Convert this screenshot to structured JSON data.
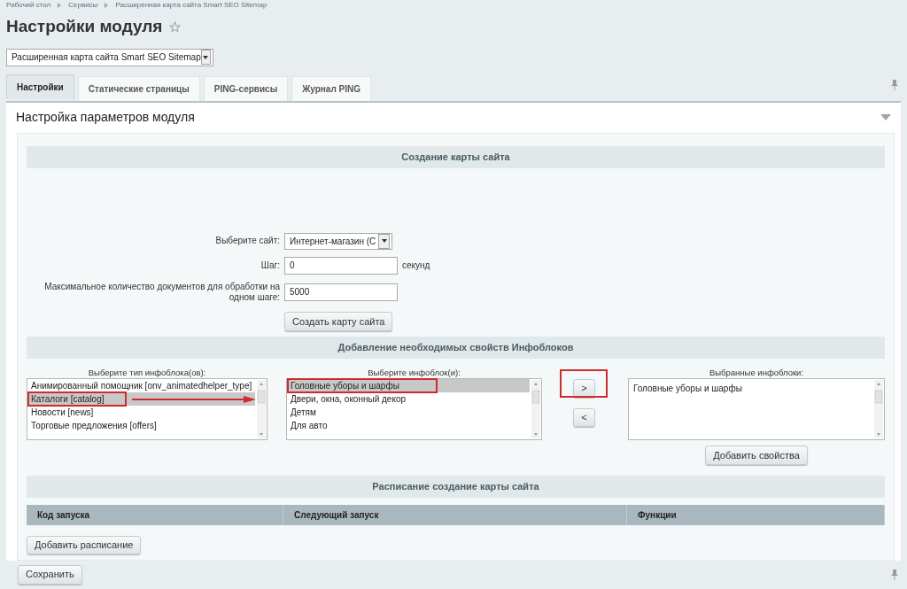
{
  "breadcrumbs": [
    "Рабочий стол",
    "Сервисы",
    "Расширенная карта сайта Smart SEO Sitemap"
  ],
  "title": "Настройки модуля",
  "module_select": {
    "value": "Расширенная карта сайта Smart SEO Sitemap"
  },
  "tabs": [
    {
      "label": "Настройки",
      "selected": true
    },
    {
      "label": "Статические страницы",
      "selected": false
    },
    {
      "label": "PING-сервисы",
      "selected": false
    },
    {
      "label": "Журнал PING",
      "selected": false
    }
  ],
  "panel_title": "Настройка параметров модуля",
  "section_create": {
    "heading": "Создание карты сайта",
    "fields": [
      {
        "kind": "select",
        "label": "Выберите сайт:",
        "value": "Интернет-магазин (С"
      },
      {
        "kind": "input",
        "label": "Шаг:",
        "value": "0",
        "suffix": "секунд"
      },
      {
        "kind": "input",
        "label": "Максимальное количество документов для обработки на одном шаге:",
        "value": "5000"
      }
    ],
    "button": "Создать карту сайта"
  },
  "section_props": {
    "heading": "Добавление необходимых свойств Инфоблоков",
    "types_label": "Выберите тип инфоблока(ов):",
    "types": [
      {
        "label": "Анимированный помощник [onv_animatedhelper_type]",
        "selected": false,
        "highlighted": false
      },
      {
        "label": "Каталоги [catalog]",
        "selected": true,
        "highlighted": true
      },
      {
        "label": "Новости [news]",
        "selected": false,
        "highlighted": false
      },
      {
        "label": "Торговые предложения [offers]",
        "selected": false,
        "highlighted": false
      }
    ],
    "iblocks_label": "Выберите инфоблок(и):",
    "iblocks": [
      {
        "label": "Головные уборы и шарфы",
        "selected": true,
        "highlighted": true
      },
      {
        "label": "Двери, окна, оконный декор",
        "selected": false,
        "highlighted": false
      },
      {
        "label": "Детям",
        "selected": false,
        "highlighted": false
      },
      {
        "label": "Для авто",
        "selected": false,
        "highlighted": false
      }
    ],
    "move_buttons": [
      {
        "label": ">",
        "highlighted": true
      },
      {
        "label": "<",
        "highlighted": false
      }
    ],
    "chosen_label": "Выбранные инфоблоки:",
    "chosen": [
      "Головные уборы и шарфы"
    ],
    "button": "Добавить свойства"
  },
  "section_schedule": {
    "heading": "Расписание создание карты сайта",
    "columns": [
      "Код запуска",
      "Следующий запуск",
      "Функции"
    ],
    "button": "Добавить расписание"
  },
  "save_button": "Сохранить"
}
